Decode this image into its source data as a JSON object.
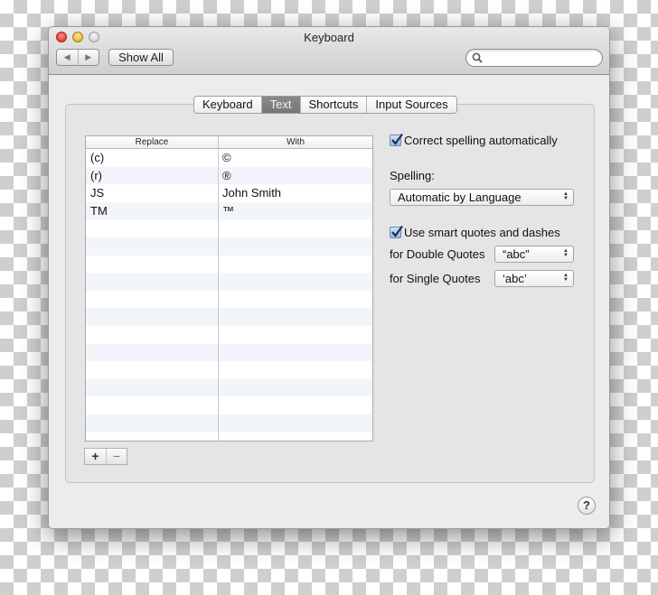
{
  "window": {
    "title": "Keyboard",
    "nav": {
      "back_icon": "back-arrow-icon",
      "forward_icon": "forward-arrow-icon"
    },
    "show_all_label": "Show All",
    "search": {
      "placeholder": "",
      "value": "",
      "icon": "search-icon"
    }
  },
  "tabs": [
    {
      "label": "Keyboard",
      "active": false
    },
    {
      "label": "Text",
      "active": true
    },
    {
      "label": "Shortcuts",
      "active": false
    },
    {
      "label": "Input Sources",
      "active": false
    }
  ],
  "replacements": {
    "headers": {
      "replace": "Replace",
      "with": "With"
    },
    "rows": [
      {
        "replace": "(c)",
        "with": "©"
      },
      {
        "replace": "(r)",
        "with": "®"
      },
      {
        "replace": "JS",
        "with": "John Smith"
      },
      {
        "replace": "TM",
        "with": "™"
      }
    ],
    "add_label": "+",
    "remove_label": "−"
  },
  "options": {
    "correct_spelling": {
      "label": "Correct spelling automatically",
      "checked": true
    },
    "spelling_label": "Spelling:",
    "spelling_value": "Automatic by Language",
    "smart_quotes": {
      "label": "Use smart quotes and dashes",
      "checked": true
    },
    "double_quotes": {
      "label": "for Double Quotes",
      "value": "“abc”"
    },
    "single_quotes": {
      "label": "for Single Quotes",
      "value": "‘abc’"
    }
  },
  "help_label": "?",
  "colors": {
    "active_tab": "#7f7f7f",
    "checkbox": "#9ab8e6",
    "close": "#d7201c",
    "minimize": "#e2a119",
    "zoom": "#c4c4c4"
  }
}
